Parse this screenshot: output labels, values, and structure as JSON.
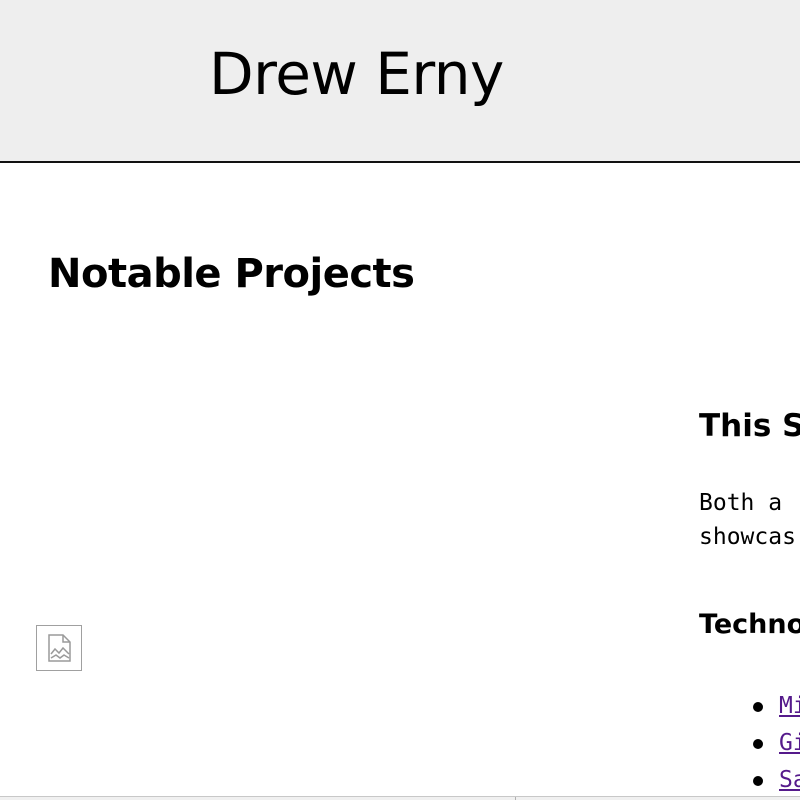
{
  "header": {
    "title": "Drew Erny",
    "background": "#eeeeee"
  },
  "main": {
    "section_heading": "Notable Projects",
    "project": {
      "image_state": "broken-image-icon",
      "title": "This St",
      "description_lines": [
        "Both a",
        "showcas"
      ],
      "technologies_heading": "Techno",
      "technologies": [
        {
          "label": "Mi"
        },
        {
          "label": "Gi"
        },
        {
          "label": "Sa"
        }
      ],
      "link_color": "#551a8b"
    }
  }
}
